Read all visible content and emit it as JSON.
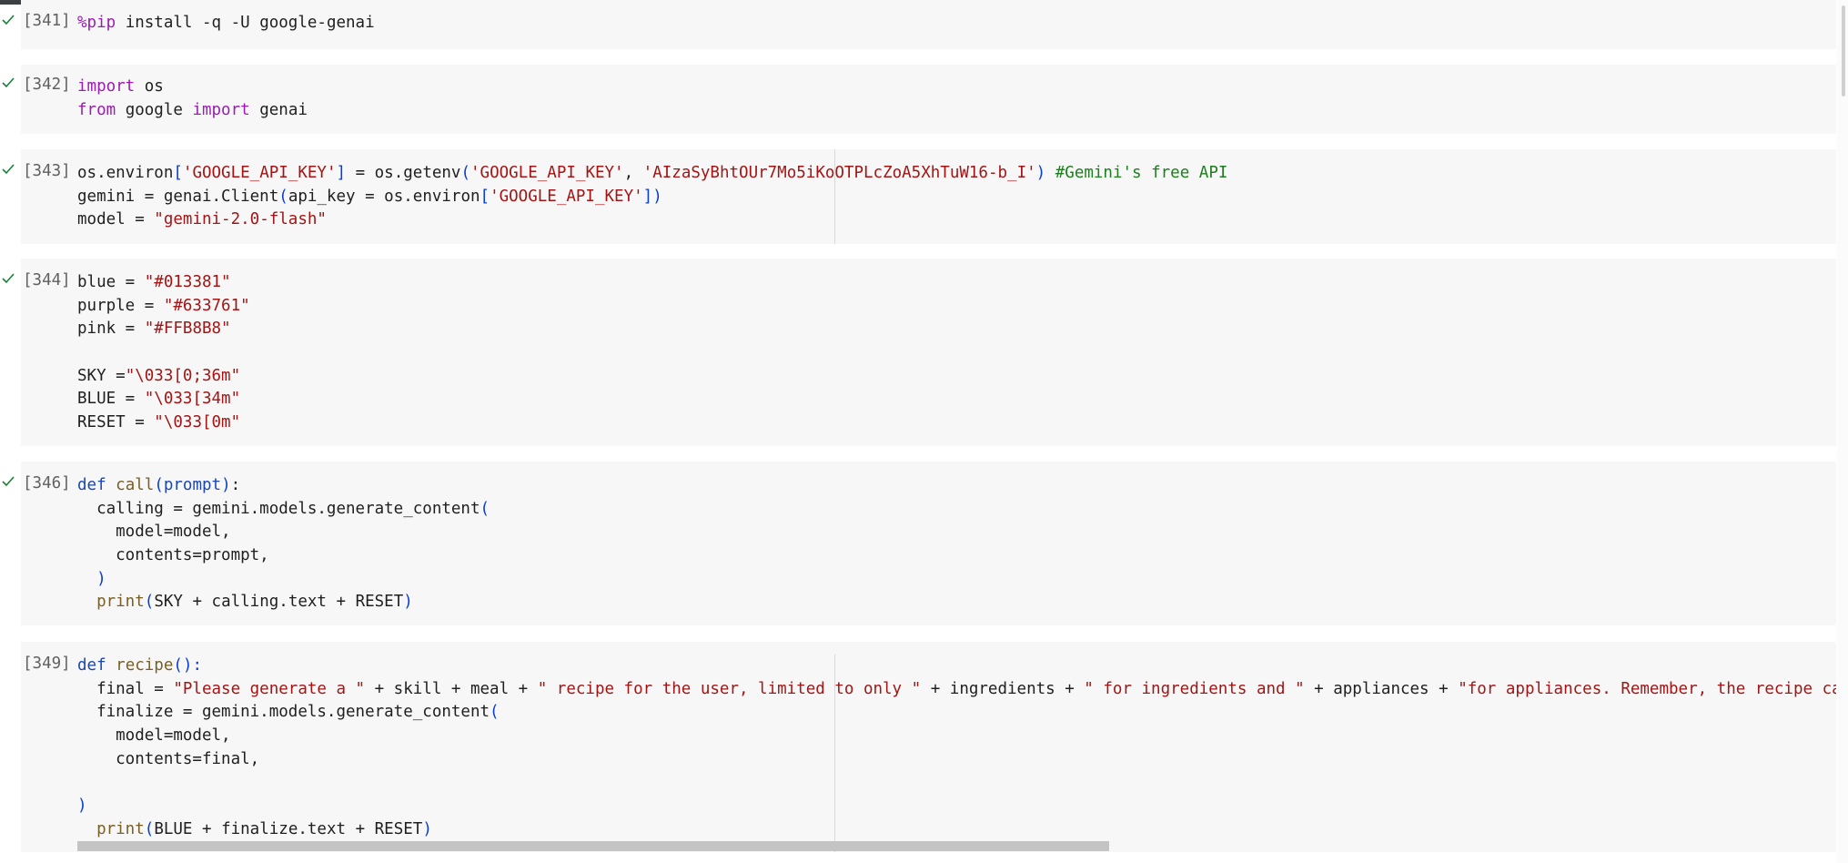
{
  "cells": [
    {
      "number": "[341]",
      "lines": [
        [
          {
            "t": "%pip",
            "c": "mg"
          },
          {
            "t": " install -q -U google-genai",
            "c": ""
          }
        ]
      ]
    },
    {
      "number": "[342]",
      "lines": [
        [
          {
            "t": "import",
            "c": "kw2"
          },
          {
            "t": " os",
            "c": ""
          }
        ],
        [
          {
            "t": "from",
            "c": "kw2"
          },
          {
            "t": " google ",
            "c": ""
          },
          {
            "t": "import",
            "c": "kw2"
          },
          {
            "t": " genai",
            "c": ""
          }
        ]
      ]
    },
    {
      "number": "[343]",
      "lines": [
        [
          {
            "t": "os.environ",
            "c": ""
          },
          {
            "t": "[",
            "c": "br"
          },
          {
            "t": "'GOOGLE_API_KEY'",
            "c": "str"
          },
          {
            "t": "]",
            "c": "br"
          },
          {
            "t": " = os.getenv",
            "c": ""
          },
          {
            "t": "(",
            "c": "br"
          },
          {
            "t": "'GOOGLE_API_KEY'",
            "c": "str"
          },
          {
            "t": ", ",
            "c": ""
          },
          {
            "t": "'AIzaSyBhtOUr7Mo5iKoOTPLcZoA5XhTuW16-b_I'",
            "c": "str"
          },
          {
            "t": ")",
            "c": "br"
          },
          {
            "t": " ",
            "c": ""
          },
          {
            "t": "#Gemini's free API",
            "c": "cm"
          }
        ],
        [
          {
            "t": "gemini = genai.Client",
            "c": ""
          },
          {
            "t": "(",
            "c": "br"
          },
          {
            "t": "api_key = os.environ",
            "c": ""
          },
          {
            "t": "[",
            "c": "br"
          },
          {
            "t": "'GOOGLE_API_KEY'",
            "c": "str"
          },
          {
            "t": "])",
            "c": "br"
          }
        ],
        [
          {
            "t": "model = ",
            "c": ""
          },
          {
            "t": "\"gemini-2.0-flash\"",
            "c": "str"
          }
        ]
      ]
    },
    {
      "number": "[344]",
      "lines": [
        [
          {
            "t": "blue = ",
            "c": ""
          },
          {
            "t": "\"#013381\"",
            "c": "str"
          }
        ],
        [
          {
            "t": "purple = ",
            "c": ""
          },
          {
            "t": "\"#633761\"",
            "c": "str"
          }
        ],
        [
          {
            "t": "pink = ",
            "c": ""
          },
          {
            "t": "\"#FFB8B8\"",
            "c": "str"
          }
        ],
        [],
        [
          {
            "t": "SKY =",
            "c": ""
          },
          {
            "t": "\"\\033[0;36m\"",
            "c": "str"
          }
        ],
        [
          {
            "t": "BLUE = ",
            "c": ""
          },
          {
            "t": "\"\\033[34m\"",
            "c": "str"
          }
        ],
        [
          {
            "t": "RESET = ",
            "c": ""
          },
          {
            "t": "\"\\033[0m\"",
            "c": "str"
          }
        ]
      ]
    },
    {
      "number": "[346]",
      "lines": [
        [
          {
            "t": "def",
            "c": "kw"
          },
          {
            "t": " ",
            "c": ""
          },
          {
            "t": "call",
            "c": "fn"
          },
          {
            "t": "(",
            "c": "br"
          },
          {
            "t": "prompt",
            "c": "kw"
          },
          {
            "t": ")",
            "c": "br"
          },
          {
            "t": ":",
            "c": ""
          }
        ],
        [
          {
            "t": "  calling = gemini.models.generate_content",
            "c": ""
          },
          {
            "t": "(",
            "c": "br"
          }
        ],
        [
          {
            "t": "    model=model,",
            "c": ""
          }
        ],
        [
          {
            "t": "    contents=prompt,",
            "c": ""
          }
        ],
        [
          {
            "t": "  ",
            "c": ""
          },
          {
            "t": ")",
            "c": "br"
          }
        ],
        [
          {
            "t": "  ",
            "c": ""
          },
          {
            "t": "print",
            "c": "fn"
          },
          {
            "t": "(",
            "c": "br"
          },
          {
            "t": "SKY + calling.text + RESET",
            "c": ""
          },
          {
            "t": ")",
            "c": "br"
          }
        ]
      ]
    },
    {
      "number": "[349]",
      "lines": [
        [
          {
            "t": "def",
            "c": "kw"
          },
          {
            "t": " ",
            "c": ""
          },
          {
            "t": "recipe",
            "c": "fn"
          },
          {
            "t": "():",
            "c": "br"
          }
        ],
        [
          {
            "t": "  final = ",
            "c": ""
          },
          {
            "t": "\"Please generate a \"",
            "c": "str"
          },
          {
            "t": " + skill + meal + ",
            "c": ""
          },
          {
            "t": "\" recipe for the user, limited to only \"",
            "c": "str"
          },
          {
            "t": " + ingredients + ",
            "c": ""
          },
          {
            "t": "\" for ingredients and \"",
            "c": "str"
          },
          {
            "t": " + appliances + ",
            "c": ""
          },
          {
            "t": "\"for appliances. Remember, the recipe can",
            "c": "str"
          }
        ],
        [
          {
            "t": "  finalize = gemini.models.generate_content",
            "c": ""
          },
          {
            "t": "(",
            "c": "br"
          }
        ],
        [
          {
            "t": "    model=model,",
            "c": ""
          }
        ],
        [
          {
            "t": "    contents=final,",
            "c": ""
          }
        ],
        [],
        [
          {
            "t": ")",
            "c": "br"
          }
        ],
        [
          {
            "t": "  ",
            "c": ""
          },
          {
            "t": "print",
            "c": "fn"
          },
          {
            "t": "(",
            "c": "br"
          },
          {
            "t": "BLUE + finalize.text + RESET",
            "c": ""
          },
          {
            "t": ")",
            "c": "br"
          }
        ]
      ]
    }
  ]
}
